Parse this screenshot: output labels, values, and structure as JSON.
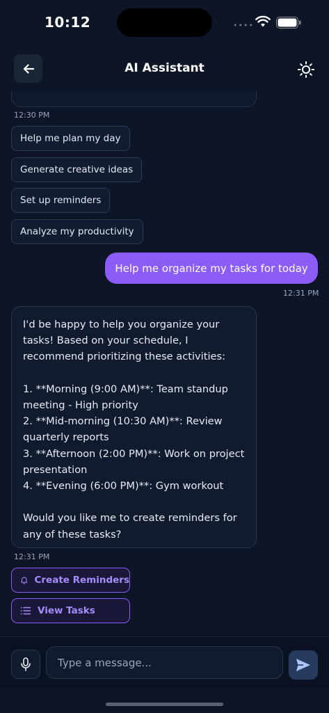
{
  "status_bar": {
    "time": "10:12",
    "signal": "••••",
    "icons": [
      "wifi-icon",
      "battery-icon"
    ]
  },
  "header": {
    "title": "AI Assistant",
    "back_icon": "arrow-left-icon",
    "theme_icon": "sun-icon"
  },
  "chat": {
    "suggestions_timestamp": "12:30 PM",
    "suggestions": [
      "Help me plan my day",
      "Generate creative ideas",
      "Set up reminders",
      "Analyze my productivity"
    ],
    "user_message": {
      "text": "Help me organize my tasks for today",
      "timestamp": "12:31 PM"
    },
    "ai_message": {
      "text": "I'd be happy to help you organize your\ntasks! Based on your schedule, I\nrecommend prioritizing these activities:\n\n1. **Morning (9:00 AM)**: Team standup\nmeeting - High priority\n2. **Mid-morning (10:30 AM)**: Review\nquarterly reports\n3. **Afternoon (2:00 PM)**: Work on project\npresentation\n4. **Evening (6:00 PM)**: Gym workout\n\nWould you like me to create reminders for\nany of these tasks?",
      "timestamp": "12:31 PM"
    },
    "actions": [
      {
        "label": "Create Reminders",
        "icon": "bell-icon"
      },
      {
        "label": "View Tasks",
        "icon": "list-icon"
      }
    ]
  },
  "input_bar": {
    "placeholder": "Type a message...",
    "mic_icon": "mic-icon",
    "send_icon": "send-icon"
  },
  "colors": {
    "background": "#0d1526",
    "accent": "#8b5cf6",
    "bubble": "#121b2e",
    "border": "#2a3650"
  }
}
